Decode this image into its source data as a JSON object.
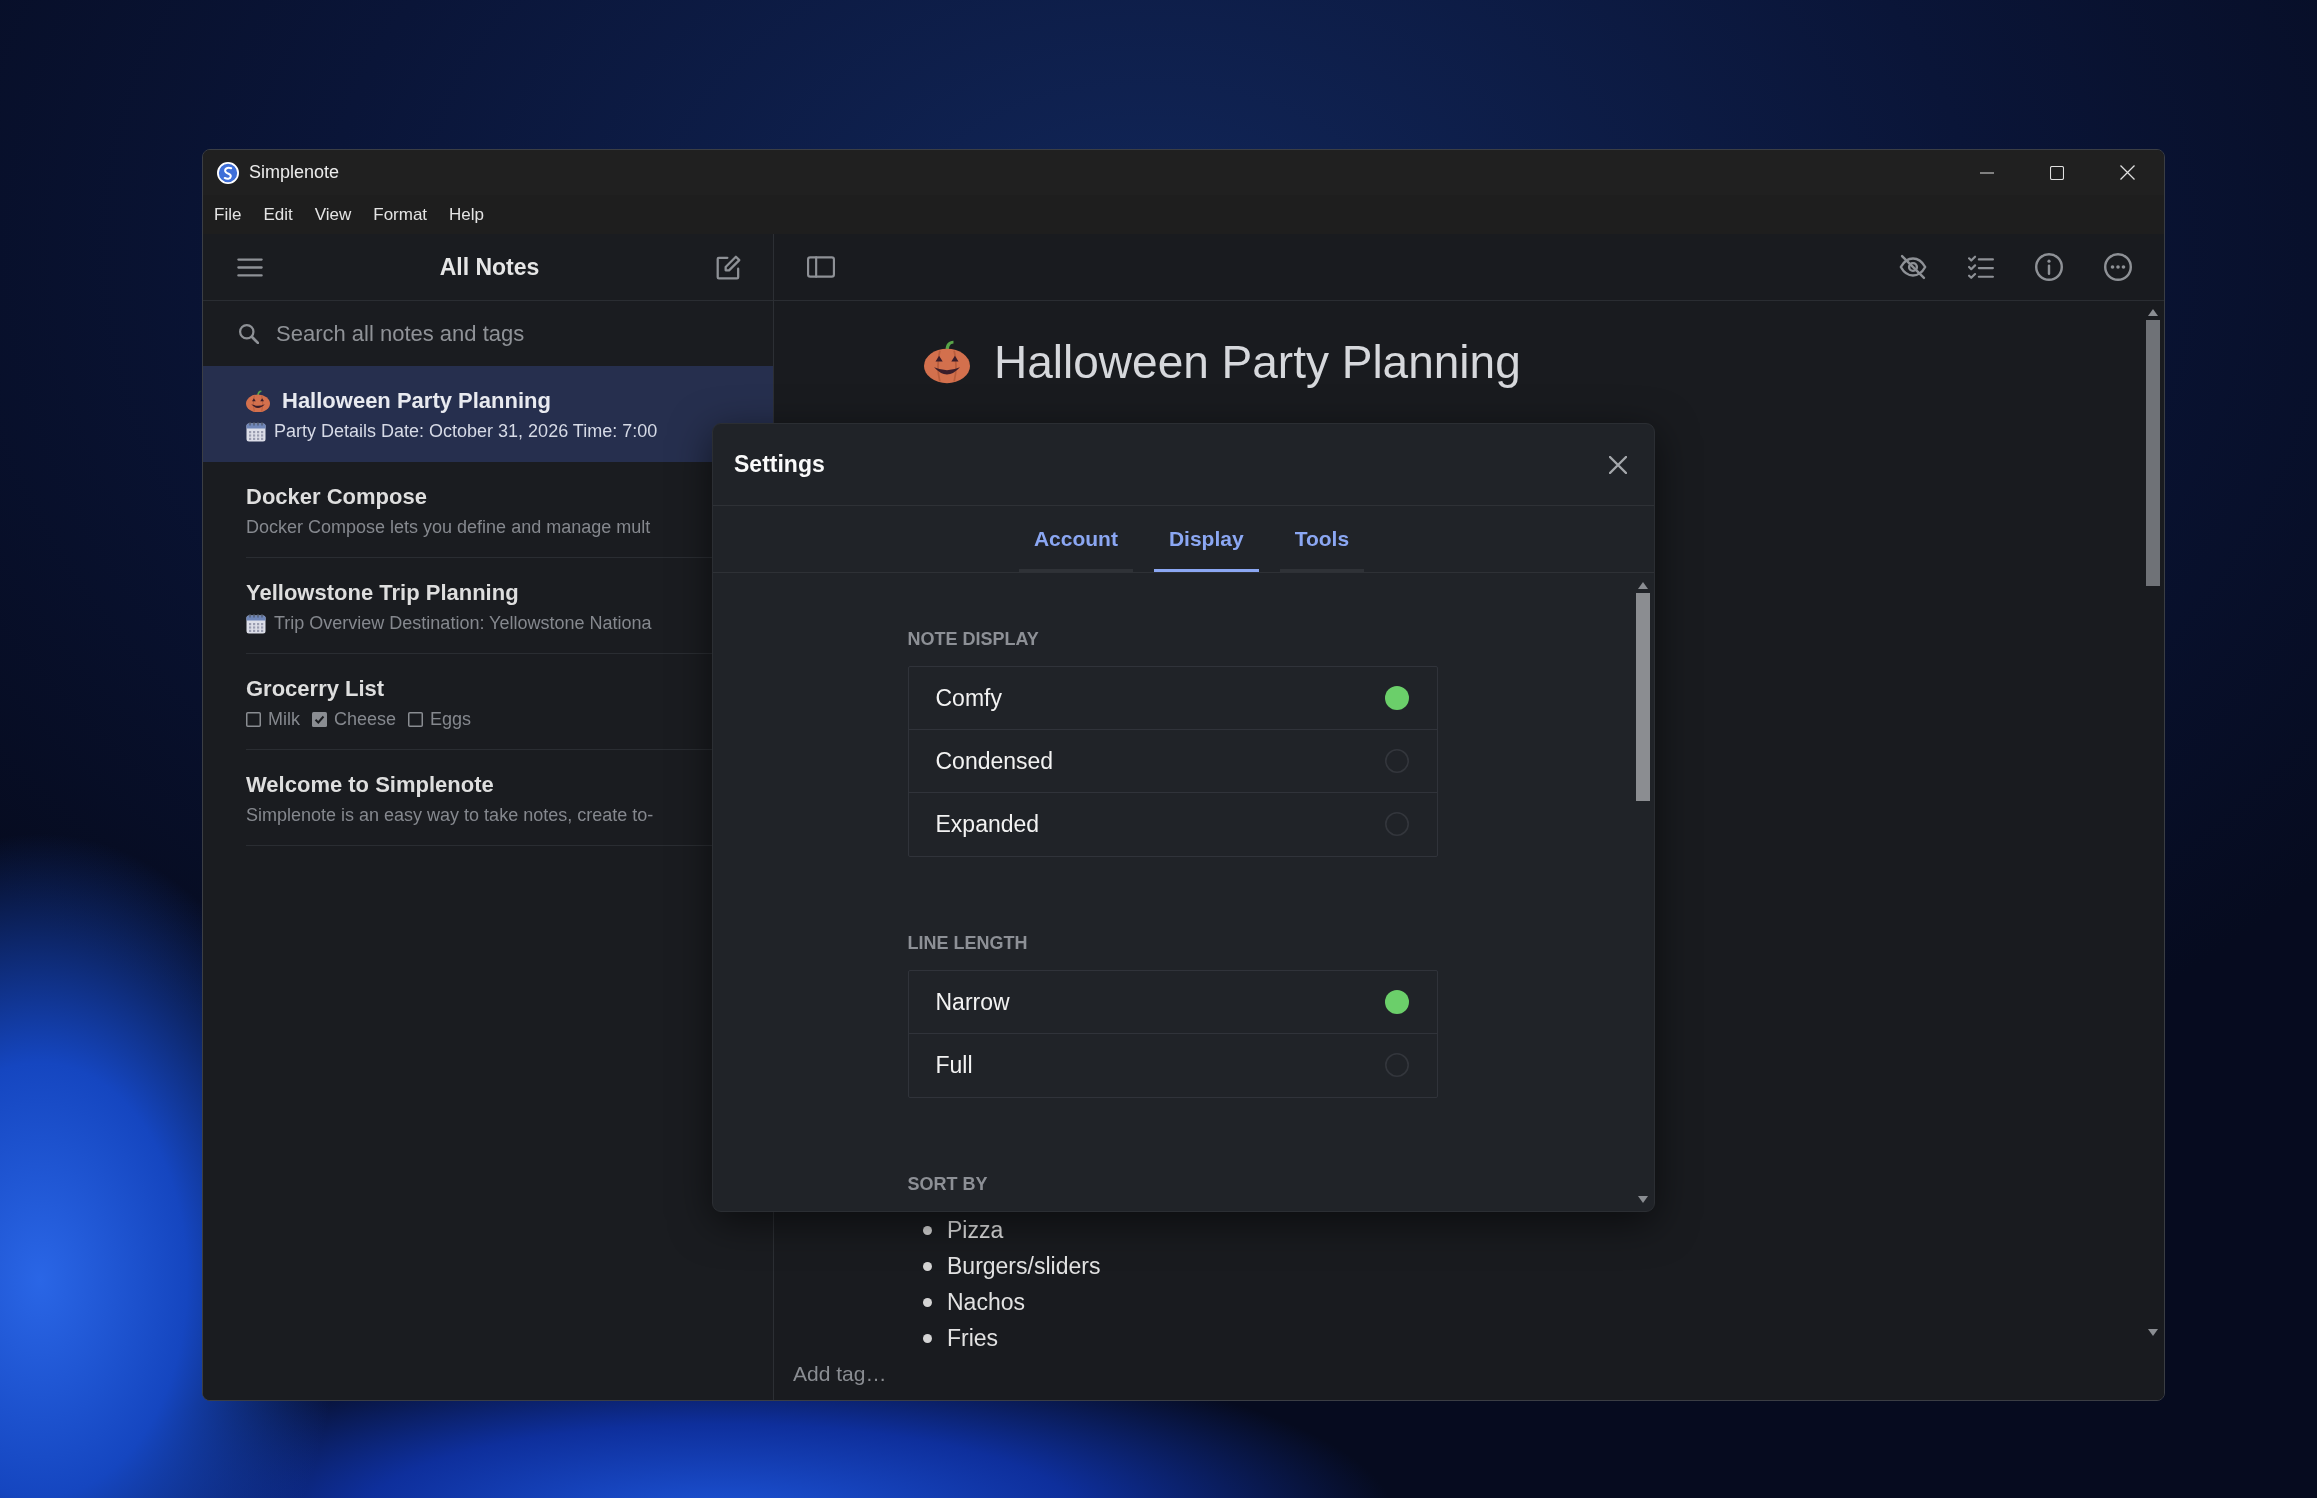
{
  "window": {
    "title": "Simplenote"
  },
  "menu": [
    "File",
    "Edit",
    "View",
    "Format",
    "Help"
  ],
  "sidebar": {
    "title": "All Notes",
    "search": {
      "placeholder": "Search all notes and tags"
    },
    "notes": [
      {
        "title": "Halloween Party Planning",
        "title_emoji": true,
        "preview": {
          "kind": "dated",
          "text": "Party Details Date: October 31, 2026 Time: 7:00"
        },
        "selected": true
      },
      {
        "title": "Docker Compose",
        "title_emoji": false,
        "preview": {
          "kind": "plain",
          "text": "Docker Compose lets you define and manage mult"
        },
        "selected": false
      },
      {
        "title": "Yellowstone Trip Planning",
        "title_emoji": false,
        "preview": {
          "kind": "dated",
          "text": "Trip Overview Destination: Yellowstone Nationa"
        },
        "selected": false
      },
      {
        "title": "Grocerry List",
        "title_emoji": false,
        "preview": {
          "kind": "checklist",
          "items": [
            {
              "label": "Milk",
              "checked": false
            },
            {
              "label": "Cheese",
              "checked": true
            },
            {
              "label": "Eggs",
              "checked": false
            }
          ]
        },
        "selected": false
      },
      {
        "title": "Welcome to Simplenote",
        "title_emoji": false,
        "preview": {
          "kind": "plain",
          "text": "Simplenote is an easy way to take notes, create to-"
        },
        "selected": false
      }
    ]
  },
  "editor": {
    "title": "Halloween Party Planning",
    "title_emoji": true,
    "bullets": [
      "Pizza",
      "Burgers/sliders",
      "Nachos",
      "Fries"
    ],
    "tag_field": {
      "placeholder": "Add tag…"
    }
  },
  "settings": {
    "title": "Settings",
    "tabs": [
      {
        "label": "Account",
        "selected": false
      },
      {
        "label": "Display",
        "selected": true
      },
      {
        "label": "Tools",
        "selected": false
      }
    ],
    "sections": [
      {
        "heading": "NOTE DISPLAY",
        "options": [
          {
            "label": "Comfy",
            "selected": true
          },
          {
            "label": "Condensed",
            "selected": false
          },
          {
            "label": "Expanded",
            "selected": false
          }
        ]
      },
      {
        "heading": "LINE LENGTH",
        "options": [
          {
            "label": "Narrow",
            "selected": true
          },
          {
            "label": "Full",
            "selected": false
          }
        ]
      },
      {
        "heading": "SORT BY"
      }
    ]
  }
}
